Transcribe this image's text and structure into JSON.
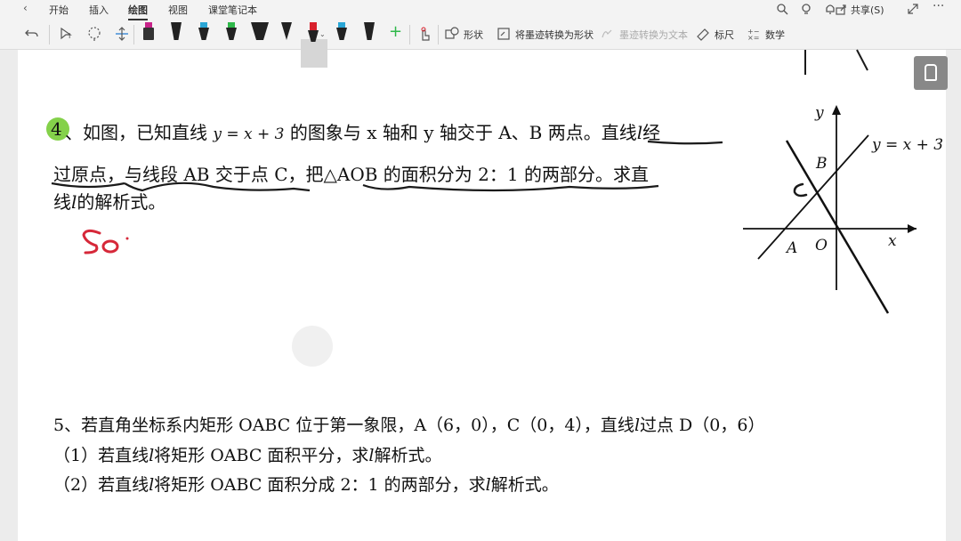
{
  "ribbon": {
    "back_glyph": "‹",
    "tabs": [
      {
        "label": "开始",
        "active": false
      },
      {
        "label": "插入",
        "active": false
      },
      {
        "label": "绘图",
        "active": true
      },
      {
        "label": "视图",
        "active": false
      },
      {
        "label": "课堂笔记本",
        "active": false
      }
    ],
    "share_label": "共享(S)"
  },
  "toolbar": {
    "shape_label": "形状",
    "ink_to_shape_label": "将墨迹转换为形状",
    "ink_to_text_label": "墨迹转换为文本",
    "ruler_label": "标尺",
    "math_label": "数学",
    "pen_colors": [
      "#c8248a",
      "#222222",
      "#2aa6d6",
      "#2fb84a",
      "#222222",
      "#222222",
      "#d8202c",
      "#2aa6d6",
      "#222222"
    ]
  },
  "question4": {
    "num_circle": "4",
    "line1_a": "、如图，已知直线 ",
    "eq": "y = x + 3",
    "line1_b": " 的图象与 x 轴和 y 轴交于 A、B 两点。直线",
    "l": "l",
    "line1_c": "经",
    "line2": "过原点，与线段 AB 交于点 C，把△AOB 的面积分为 2：1 的两部分。求直",
    "line3_a": "线",
    "line3_b": "的解析式。",
    "handwriting": "So"
  },
  "graph": {
    "label_y": "y",
    "label_x": "x",
    "label_eq": "y = x + 3",
    "label_B": "B",
    "label_A": "A",
    "label_O": "O",
    "label_C": "C"
  },
  "question5": {
    "line1": "5、若直角坐标系内矩形 OABC 位于第一象限，A（6，0），C（0，4），直线",
    "line1_l": "l",
    "line1_b": "过点 D（0，6）",
    "line2_a": "（1）若直线",
    "line2_b": "将矩形 OABC 面积平分，求",
    "line2_c": "解析式。",
    "line3_a": "（2）若直线",
    "line3_b": "将矩形 OABC 面积分成 2：1 的两部分，求",
    "line3_c": "解析式。"
  },
  "colors": {
    "ink_red": "#d62839",
    "ink_black": "#1a1a1a",
    "highlight": "#6ec92a"
  }
}
